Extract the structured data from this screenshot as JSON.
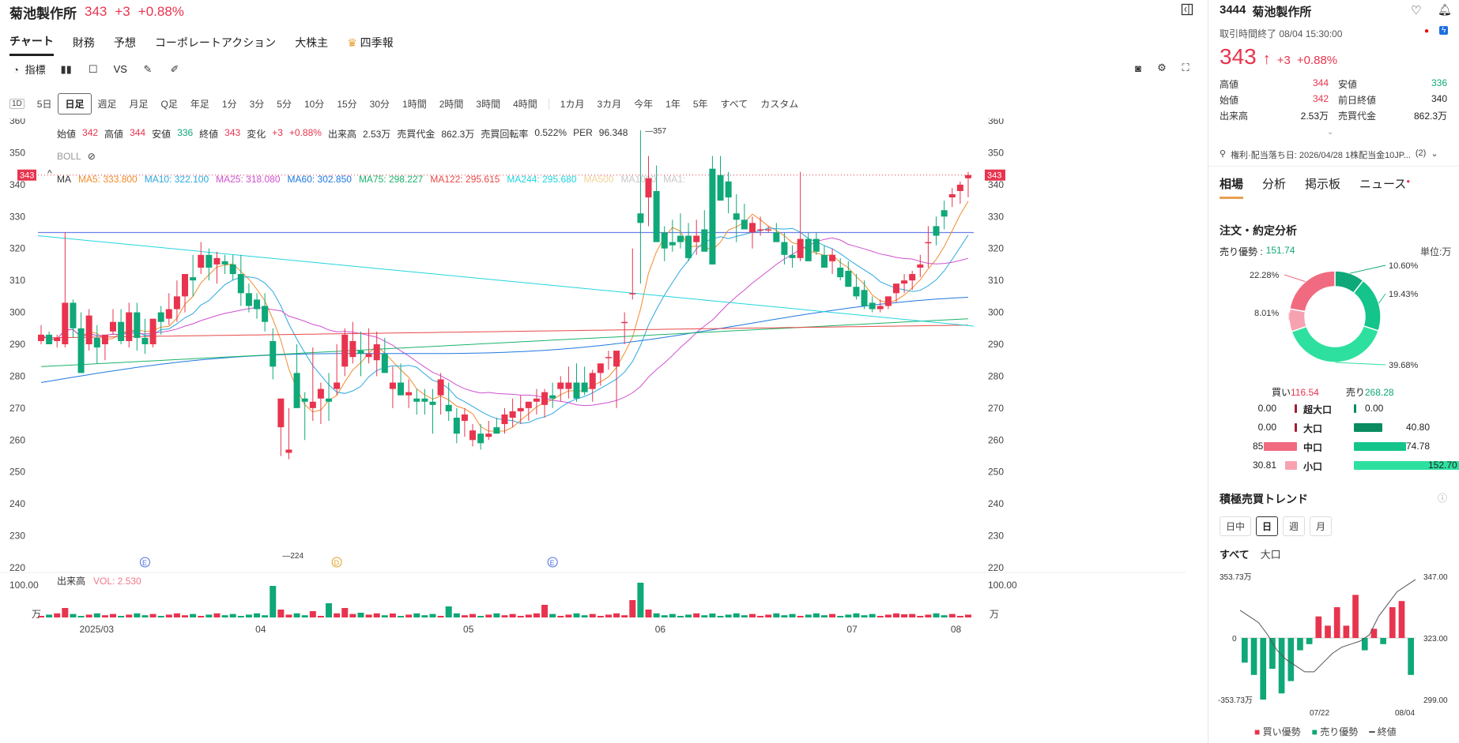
{
  "header": {
    "name": "菊池製作所",
    "price": "343",
    "change": "+3",
    "pct": "+0.88%"
  },
  "tabs": [
    "チャート",
    "財務",
    "予想",
    "コーポレートアクション",
    "大株主",
    "四季報"
  ],
  "toolbar": {
    "indicators": "指標",
    "vs": "VS"
  },
  "timeframes": [
    "5日",
    "日足",
    "週足",
    "月足",
    "Q足",
    "年足",
    "1分",
    "3分",
    "5分",
    "10分",
    "15分",
    "30分",
    "1時間",
    "2時間",
    "3時間",
    "4時間"
  ],
  "ranges": [
    "1カ月",
    "3カ月",
    "今年",
    "1年",
    "5年",
    "すべて",
    "カスタム"
  ],
  "ohlc": {
    "open_label": "始値",
    "open": "342",
    "high_label": "高値",
    "high": "344",
    "low_label": "安値",
    "low": "336",
    "close_label": "終値",
    "close": "343",
    "chg_label": "変化",
    "chg": "+3",
    "chg_pct": "+0.88%",
    "vol_label": "出来高",
    "vol": "2.53万",
    "amt_label": "売買代金",
    "amt": "862.3万",
    "turn_label": "売買回転率",
    "turn": "0.522%",
    "per_label": "PER",
    "per": "96.348"
  },
  "boll": "BOLL",
  "ma": {
    "label": "MA",
    "items": [
      {
        "text": "MA5: 333.800",
        "color": "#f08c2c"
      },
      {
        "text": "MA10: 322.100",
        "color": "#2ba8e0"
      },
      {
        "text": "MA25: 318.080",
        "color": "#d050d0"
      },
      {
        "text": "MA60: 302.850",
        "color": "#1e78e0"
      },
      {
        "text": "MA75: 298.227",
        "color": "#1bb36a"
      },
      {
        "text": "MA122: 295.615",
        "color": "#e84848"
      },
      {
        "text": "MA244: 295.680",
        "color": "#22d4e0"
      },
      {
        "text": "MA500",
        "color": "#f5d29a"
      },
      {
        "text": "MA1000",
        "color": "#c9c9c9"
      },
      {
        "text": "MA1:",
        "color": "#c9c9c9"
      }
    ]
  },
  "price_label": "343",
  "chart_data": {
    "type": "candlestick",
    "ylim": [
      220,
      360
    ],
    "yticks": [
      360,
      350,
      340,
      330,
      320,
      310,
      300,
      290,
      280,
      270,
      260,
      250,
      240,
      230,
      220
    ],
    "xticks": [
      "2025/03",
      "04",
      "05",
      "06",
      "07",
      "08"
    ],
    "annotations": {
      "max": "357",
      "min": "224",
      "events": [
        "E",
        "D",
        "E"
      ]
    },
    "hline": 325,
    "candles": [
      [
        291,
        296,
        290,
        293
      ],
      [
        293,
        294,
        290,
        290
      ],
      [
        291,
        293,
        289,
        292
      ],
      [
        290,
        325,
        289,
        303
      ],
      [
        303,
        304,
        292,
        295
      ],
      [
        295,
        300,
        287,
        281
      ],
      [
        290,
        301,
        288,
        299
      ],
      [
        292,
        296,
        284,
        289
      ],
      [
        290,
        293,
        285,
        293
      ],
      [
        294,
        301,
        293,
        297
      ],
      [
        297,
        301,
        290,
        291
      ],
      [
        291,
        303,
        289,
        300
      ],
      [
        300,
        303,
        288,
        292
      ],
      [
        292,
        298,
        287,
        290
      ],
      [
        290,
        296,
        289,
        298
      ],
      [
        300,
        302,
        293,
        297
      ],
      [
        298,
        306,
        296,
        301
      ],
      [
        301,
        310,
        297,
        305
      ],
      [
        305,
        312,
        300,
        312
      ],
      [
        311,
        318,
        305,
        310
      ],
      [
        314,
        322,
        312,
        318
      ],
      [
        318,
        320,
        310,
        314
      ],
      [
        315,
        319,
        309,
        317
      ],
      [
        316,
        318,
        312,
        315
      ],
      [
        315,
        318,
        310,
        312
      ],
      [
        312,
        318,
        302,
        306
      ],
      [
        306,
        309,
        300,
        302
      ],
      [
        304,
        306,
        298,
        301
      ],
      [
        302,
        306,
        294,
        297
      ],
      [
        291,
        295,
        279,
        283
      ],
      [
        264,
        272,
        255,
        273
      ],
      [
        256,
        270,
        254,
        257
      ],
      [
        281,
        290,
        272,
        270
      ],
      [
        273,
        275,
        260,
        272
      ],
      [
        270,
        289,
        266,
        272
      ],
      [
        273,
        278,
        265,
        276
      ],
      [
        273,
        281,
        266,
        272
      ],
      [
        276,
        290,
        274,
        278
      ],
      [
        283,
        295,
        280,
        293
      ],
      [
        286,
        297,
        284,
        291
      ],
      [
        288,
        294,
        280,
        287
      ],
      [
        286,
        295,
        284,
        287
      ],
      [
        285,
        294,
        280,
        290
      ],
      [
        287,
        292,
        282,
        281
      ],
      [
        276,
        283,
        270,
        278
      ],
      [
        278,
        284,
        274,
        274
      ],
      [
        274,
        279,
        270,
        275
      ],
      [
        273,
        276,
        268,
        272
      ],
      [
        273,
        276,
        268,
        272
      ],
      [
        272,
        276,
        262,
        271
      ],
      [
        274,
        281,
        268,
        279
      ],
      [
        271,
        278,
        266,
        269
      ],
      [
        267,
        270,
        259,
        262
      ],
      [
        266,
        270,
        261,
        268
      ],
      [
        260,
        265,
        258,
        263
      ],
      [
        262,
        265,
        257,
        259
      ],
      [
        261,
        266,
        260,
        262
      ],
      [
        264,
        267,
        262,
        262
      ],
      [
        265,
        270,
        262,
        268
      ],
      [
        267,
        273,
        264,
        269
      ],
      [
        269,
        274,
        265,
        270
      ],
      [
        270,
        272,
        266,
        272
      ],
      [
        272,
        276,
        268,
        273
      ],
      [
        271,
        276,
        267,
        275
      ],
      [
        274,
        278,
        270,
        273
      ],
      [
        276,
        280,
        272,
        278
      ],
      [
        276,
        283,
        273,
        278
      ],
      [
        278,
        284,
        272,
        273
      ],
      [
        278,
        283,
        274,
        275
      ],
      [
        276,
        282,
        272,
        281
      ],
      [
        281,
        284,
        277,
        284
      ],
      [
        286,
        288,
        282,
        286
      ],
      [
        283,
        287,
        270,
        288
      ],
      [
        297,
        300,
        290,
        297
      ],
      [
        306,
        320,
        304,
        306
      ],
      [
        331,
        357,
        309,
        328
      ],
      [
        336,
        349,
        327,
        342
      ],
      [
        338,
        346,
        324,
        322
      ],
      [
        325,
        327,
        316,
        320
      ],
      [
        322,
        329,
        319,
        321
      ],
      [
        324,
        331,
        320,
        322
      ],
      [
        324,
        328,
        316,
        317
      ],
      [
        322,
        329,
        318,
        324
      ],
      [
        326,
        332,
        320,
        319
      ],
      [
        345,
        349,
        316,
        315
      ],
      [
        343,
        349,
        337,
        335
      ],
      [
        341,
        344,
        331,
        336
      ],
      [
        331,
        337,
        322,
        329
      ],
      [
        329,
        334,
        326,
        326
      ],
      [
        325,
        330,
        320,
        328
      ],
      [
        326,
        330,
        324,
        326
      ],
      [
        326,
        327,
        325,
        326
      ],
      [
        325,
        328,
        323,
        322
      ],
      [
        322,
        325,
        315,
        318
      ],
      [
        318,
        321,
        314,
        317
      ],
      [
        317,
        344,
        316,
        323
      ],
      [
        323,
        325,
        318,
        316
      ],
      [
        323,
        325,
        318,
        319
      ],
      [
        318,
        321,
        314,
        314
      ],
      [
        316,
        320,
        312,
        318
      ],
      [
        314,
        317,
        310,
        311
      ],
      [
        313,
        316,
        308,
        308
      ],
      [
        308,
        312,
        304,
        305
      ],
      [
        307,
        310,
        301,
        302
      ],
      [
        303,
        305,
        300,
        301
      ],
      [
        301,
        304,
        300,
        302
      ],
      [
        302,
        305,
        301,
        305
      ],
      [
        306,
        309,
        303,
        309
      ],
      [
        309,
        312,
        306,
        310
      ],
      [
        310,
        313,
        307,
        312
      ],
      [
        314,
        318,
        311,
        315
      ],
      [
        322,
        327,
        314,
        322
      ],
      [
        327,
        330,
        321,
        324
      ],
      [
        332,
        335,
        326,
        330
      ],
      [
        336,
        339,
        333,
        337
      ],
      [
        338,
        341,
        334,
        340
      ],
      [
        342,
        344,
        336,
        343
      ]
    ],
    "volume_axis": {
      "label": "出来高",
      "vol_label": "VOL: 2.530",
      "ticks": [
        "100.00",
        "万"
      ]
    }
  },
  "right": {
    "code": "3444",
    "name": "菊池製作所",
    "status": "取引時間終了 08/04 15:30:00",
    "price": "343",
    "arrow": "↑",
    "change": "+3",
    "pct": "+0.88%",
    "stats": [
      {
        "label": "高値",
        "value": "344",
        "cls": "red"
      },
      {
        "label": "安値",
        "value": "336",
        "cls": "grn"
      },
      {
        "label": "始値",
        "value": "342",
        "cls": "red"
      },
      {
        "label": "前日終値",
        "value": "340",
        "cls": ""
      },
      {
        "label": "出来高",
        "value": "2.53万",
        "cls": ""
      },
      {
        "label": "売買代金",
        "value": "862.3万",
        "cls": ""
      }
    ],
    "dividend": "権利·配当落ち日: 2026/04/28 1株配当金10JP...",
    "dividend_count": "(2)",
    "tabs": [
      "相場",
      "分析",
      "掲示板",
      "ニュース"
    ],
    "order_title": "注文・約定分析",
    "sell_adv_label": "売り優勢 :",
    "sell_adv": "151.74",
    "unit": "単位:万",
    "donut": [
      {
        "label": "10.60%",
        "value": 10.6,
        "color": "#0fa878"
      },
      {
        "label": "19.43%",
        "value": 19.43,
        "color": "#14c48a"
      },
      {
        "label": "39.68%",
        "value": 39.68,
        "color": "#2ee0a0"
      },
      {
        "label": "8.01%",
        "value": 8.01,
        "color": "#f7a2b0"
      },
      {
        "label": "22.28%",
        "value": 22.28,
        "color": "#f06a80"
      }
    ],
    "buy_label": "買い",
    "buy": "116.54",
    "sell_label": "売り",
    "sell": "268.28",
    "flow": [
      {
        "buy": "0.00",
        "label": "超大口",
        "sell": "0.00",
        "bf": 0.0,
        "sf": 0.0
      },
      {
        "buy": "0.00",
        "label": "大口",
        "sell": "40.80",
        "bf": 0.0,
        "sf": 0.27
      },
      {
        "buy": "85.73",
        "label": "中口",
        "sell": "74.78",
        "bf": 0.56,
        "sf": 0.49
      },
      {
        "buy": "30.81",
        "label": "小口",
        "sell": "152.70",
        "bf": 0.2,
        "sf": 1.0
      }
    ],
    "trend_title": "積極売買トレンド",
    "trend_tabs": [
      "日中",
      "日",
      "週",
      "月"
    ],
    "trend_sub": [
      "すべて",
      "大口"
    ],
    "trend_axis": {
      "top": "353.73万",
      "zero": "0",
      "bottom": "-353.73万",
      "rtop": "347.00",
      "rmid": "323.00",
      "rbottom": "299.00",
      "x1": "07/22",
      "x2": "08/04"
    },
    "trend_bars": [
      -0.4,
      -0.6,
      -1.0,
      -0.5,
      -0.9,
      -0.7,
      -0.2,
      -0.1,
      0.35,
      0.2,
      0.5,
      0.2,
      0.7,
      -0.2,
      0.15,
      -0.1,
      0.5,
      0.6,
      -0.6
    ],
    "trend_line": [
      0.45,
      0.35,
      0.25,
      0.05,
      -0.2,
      -0.35,
      -0.45,
      -0.55,
      -0.55,
      -0.4,
      -0.25,
      -0.15,
      -0.1,
      -0.05,
      0.05,
      0.35,
      0.55,
      0.75,
      0.85,
      0.95
    ],
    "legend": [
      "買い優勢",
      "売り優勢",
      "終値"
    ]
  }
}
